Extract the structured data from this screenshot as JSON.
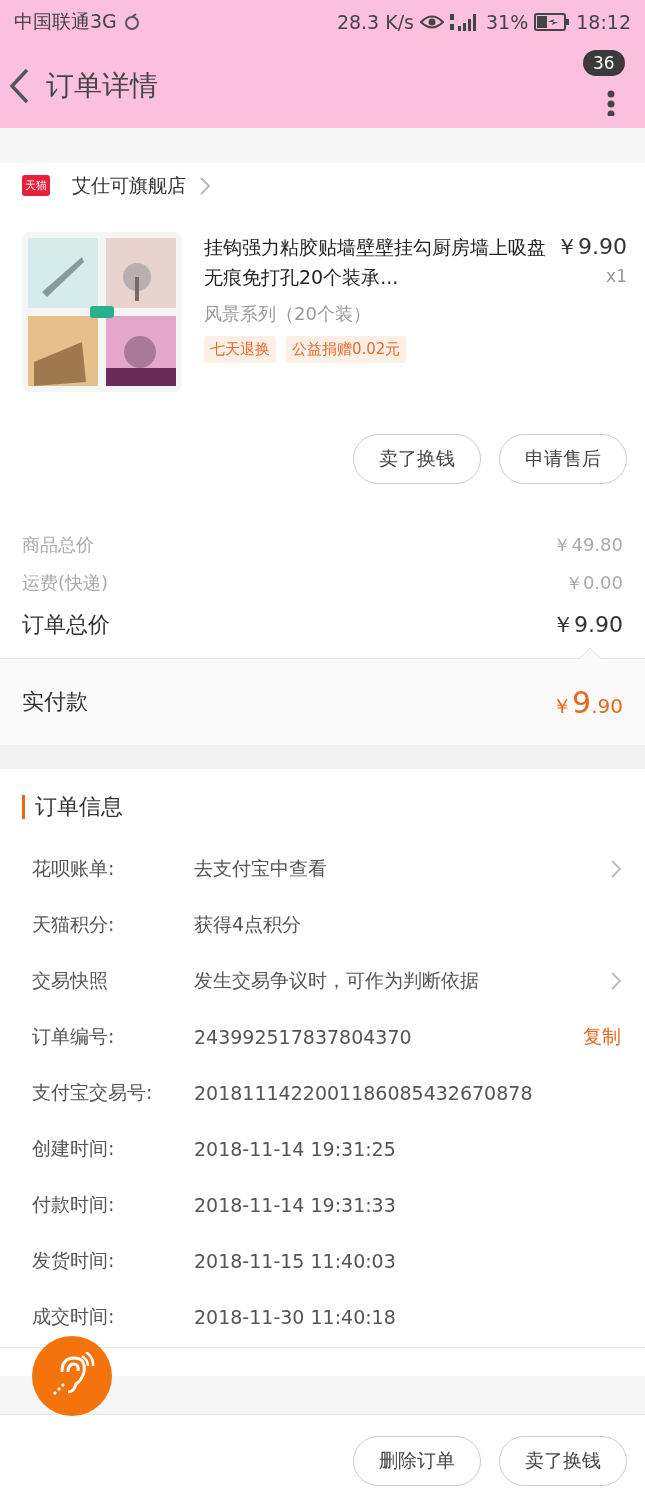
{
  "status_bar": {
    "carrier": "中国联通3G",
    "speed": "28.3 K/s",
    "battery": "31%",
    "time": "18:12"
  },
  "header": {
    "title": "订单详情",
    "badge": "36"
  },
  "store": {
    "badge": "天猫",
    "name": "艾仕可旗舰店"
  },
  "product": {
    "title": "挂钩强力粘胶贴墙壁壁挂勾厨房墙上吸盘无痕免打孔20个装承...",
    "price": "￥9.90",
    "quantity": "x1",
    "variant": "风景系列（20个装）",
    "tags": [
      "七天退换",
      "公益捐赠0.02元"
    ]
  },
  "item_actions": [
    "卖了换钱",
    "申请售后"
  ],
  "costs": [
    {
      "label": "商品总价",
      "value": "￥49.80"
    },
    {
      "label": "运费(快递)",
      "value": "￥0.00"
    }
  ],
  "total": {
    "label": "订单总价",
    "value": "￥9.90"
  },
  "paid": {
    "label": "实付款",
    "currency": "￥",
    "integer": "9",
    "decimals": ".90"
  },
  "order_info": {
    "title": "订单信息",
    "rows": [
      {
        "kind": "link",
        "label": "花呗账单:",
        "value": "去支付宝中查看"
      },
      {
        "kind": "plain",
        "label": "天猫积分:",
        "value": "获得4点积分"
      },
      {
        "kind": "link",
        "label": "交易快照",
        "value": "发生交易争议时，可作为判断依据"
      },
      {
        "kind": "copy",
        "label": "订单编号:",
        "value": "243992517837804370",
        "action": "复制"
      },
      {
        "kind": "plain",
        "label": "支付宝交易号:",
        "value": "2018111422001186085432670878"
      },
      {
        "kind": "plain",
        "label": "创建时间:",
        "value": "2018-11-14 19:31:25"
      },
      {
        "kind": "plain",
        "label": "付款时间:",
        "value": "2018-11-14 19:31:33"
      },
      {
        "kind": "plain",
        "label": "发货时间:",
        "value": "2018-11-15 11:40:03"
      },
      {
        "kind": "plain",
        "label": "成交时间:",
        "value": "2018-11-30 11:40:18"
      }
    ]
  },
  "bottom_actions": [
    "删除订单",
    "卖了换钱"
  ]
}
